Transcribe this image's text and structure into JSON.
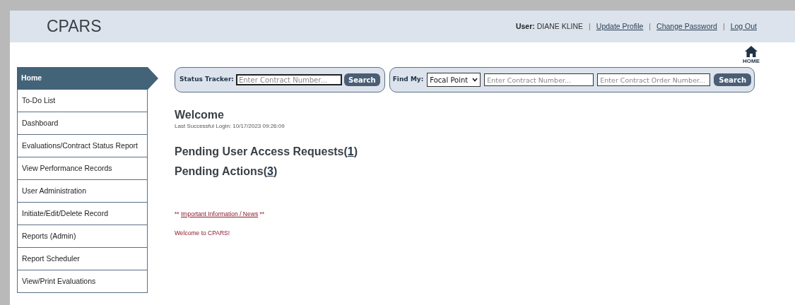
{
  "header": {
    "logo": "CPARS",
    "user_bar": [
      {
        "kind": "user",
        "label": "User:",
        "value": "DIANE KLINE"
      },
      {
        "kind": "separator",
        "text": "|"
      },
      {
        "kind": "link",
        "text": "Update Profile"
      },
      {
        "kind": "separator",
        "text": "|"
      },
      {
        "kind": "link",
        "text": "Change Password"
      },
      {
        "kind": "separator",
        "text": "|"
      },
      {
        "kind": "link",
        "text": "Log Out"
      }
    ]
  },
  "home_link": {
    "label": "HOME"
  },
  "sidebar": {
    "items": [
      {
        "label": "Home",
        "selected": true
      },
      {
        "label": "To-Do List",
        "selected": false
      },
      {
        "label": "Dashboard",
        "selected": false
      },
      {
        "label": "Evaluations/Contract Status Report",
        "selected": false
      },
      {
        "label": "View Performance Records",
        "selected": false
      },
      {
        "label": "User Administration",
        "selected": false
      },
      {
        "label": "Initiate/Edit/Delete Record",
        "selected": false
      },
      {
        "label": "Reports (Admin)",
        "selected": false
      },
      {
        "label": "Report Scheduler",
        "selected": false
      },
      {
        "label": "View/Print Evaluations",
        "selected": false
      }
    ]
  },
  "status_tracker": {
    "label": "Status Tracker:",
    "placeholder": "Enter Contract Number...",
    "button": "Search"
  },
  "find_my": {
    "label": "Find My:",
    "select_value": "Focal Point",
    "contract_placeholder": "Enter Contract Number...",
    "order_placeholder": "Enter Contract Order Number...",
    "button": "Search"
  },
  "welcome": {
    "title": "Welcome",
    "last_login": "Last Successful Login: 10/17/2023 09:26:09"
  },
  "pending": [
    {
      "label": "Pending User Access Requests",
      "open": "(",
      "count": "1",
      "close": ")"
    },
    {
      "label": "Pending Actions",
      "open": "(",
      "count": "3",
      "close": ")"
    }
  ],
  "news": {
    "prefix": "**",
    "link": "Important Information / News",
    "suffix": "**",
    "message": "Welcome to CPARS!"
  }
}
